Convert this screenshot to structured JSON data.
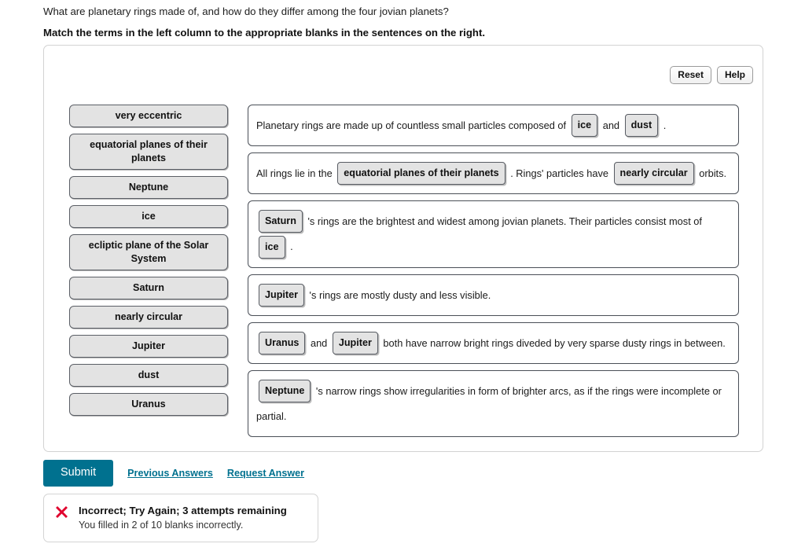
{
  "question": {
    "intro": "What are planetary rings made of, and how do they differ among the four jovian planets?",
    "instruction": "Match the terms in the left column to the appropriate blanks in the sentences on the right."
  },
  "toolbar": {
    "reset_label": "Reset",
    "help_label": "Help"
  },
  "terms": [
    {
      "label": "very eccentric",
      "lines": 1
    },
    {
      "label": "equatorial planes of their planets",
      "lines": 2
    },
    {
      "label": "Neptune",
      "lines": 1
    },
    {
      "label": "ice",
      "lines": 1
    },
    {
      "label": "ecliptic plane of the Solar System",
      "lines": 2
    },
    {
      "label": "Saturn",
      "lines": 1
    },
    {
      "label": "nearly circular",
      "lines": 1
    },
    {
      "label": "Jupiter",
      "lines": 1
    },
    {
      "label": "dust",
      "lines": 1
    },
    {
      "label": "Uranus",
      "lines": 1
    }
  ],
  "sentences": [
    {
      "parts": [
        {
          "type": "text",
          "value": "Planetary rings are made up of countless small particles composed of "
        },
        {
          "type": "chip",
          "value": "ice"
        },
        {
          "type": "text",
          "value": " and "
        },
        {
          "type": "chip",
          "value": "dust"
        },
        {
          "type": "text",
          "value": " ."
        }
      ]
    },
    {
      "parts": [
        {
          "type": "text",
          "value": "All rings lie in the "
        },
        {
          "type": "chip",
          "value": "equatorial planes of their planets"
        },
        {
          "type": "text",
          "value": " . Rings' particles have "
        },
        {
          "type": "chip",
          "value": "nearly circular"
        },
        {
          "type": "text",
          "value": " orbits."
        }
      ]
    },
    {
      "parts": [
        {
          "type": "chip",
          "value": "Saturn"
        },
        {
          "type": "text",
          "value": " 's rings are the brightest and widest among jovian planets. Their particles consist most of "
        },
        {
          "type": "chip",
          "value": "ice"
        },
        {
          "type": "text",
          "value": " ."
        }
      ]
    },
    {
      "parts": [
        {
          "type": "chip",
          "value": "Jupiter"
        },
        {
          "type": "text",
          "value": " 's rings are mostly dusty and less visible."
        }
      ]
    },
    {
      "parts": [
        {
          "type": "chip",
          "value": "Uranus"
        },
        {
          "type": "text",
          "value": " and "
        },
        {
          "type": "chip",
          "value": "Jupiter"
        },
        {
          "type": "text",
          "value": " both have narrow bright rings diveded by very sparse dusty rings in between."
        }
      ]
    },
    {
      "parts": [
        {
          "type": "chip",
          "value": "Neptune"
        },
        {
          "type": "text",
          "value": " 's narrow rings show irregularities in form of brighter arcs, as if the rings were incomplete or partial."
        }
      ]
    }
  ],
  "actions": {
    "submit_label": "Submit",
    "previous_answers_label": "Previous Answers",
    "request_answer_label": "Request Answer"
  },
  "feedback": {
    "icon": "x-mark-icon",
    "title": "Incorrect; Try Again; 3 attempts remaining",
    "detail": "You filled in 2 of 10 blanks incorrectly."
  },
  "colors": {
    "accent": "#00718f",
    "error": "#e0002d",
    "tile_fill": "#e3e3e3",
    "tile_border": "#5b5f66",
    "box_border": "#4a4f57"
  }
}
